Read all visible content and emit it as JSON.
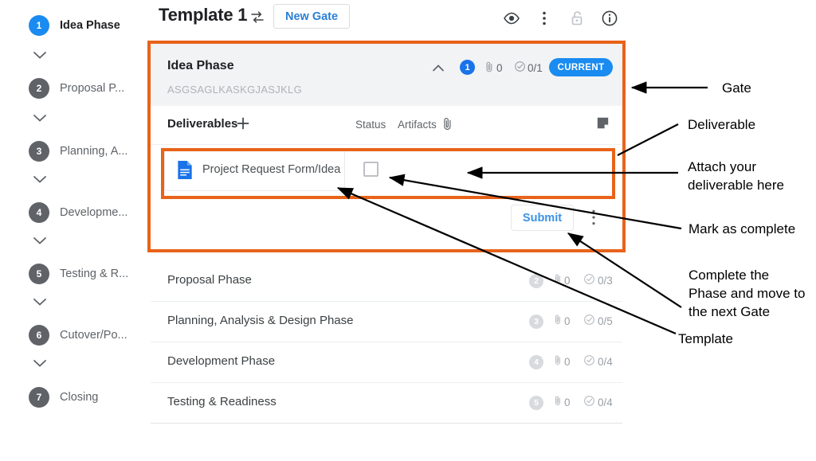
{
  "sidebar": {
    "phases": [
      {
        "num": "1",
        "label": "Idea Phase",
        "active": true
      },
      {
        "num": "2",
        "label": "Proposal P...",
        "active": false
      },
      {
        "num": "3",
        "label": "Planning, A...",
        "active": false
      },
      {
        "num": "4",
        "label": "Developme...",
        "active": false
      },
      {
        "num": "5",
        "label": "Testing & R...",
        "active": false
      },
      {
        "num": "6",
        "label": "Cutover/Po...",
        "active": false
      },
      {
        "num": "7",
        "label": "Closing",
        "active": false
      }
    ]
  },
  "header": {
    "title": "Template 1",
    "swap_icon": "swap-icon",
    "new_gate_label": "New Gate",
    "icons": [
      {
        "name": "eye-icon"
      },
      {
        "name": "more-vertical-icon"
      },
      {
        "name": "unlock-icon"
      },
      {
        "name": "info-icon"
      }
    ]
  },
  "gate": {
    "title": "Idea Phase",
    "subtitle": "ASGSAGLKASKGJASJKLG",
    "collapse_icon": "chevron-up-icon",
    "number_badge": "1",
    "attachments": "0",
    "completed": "0/1",
    "status_pill": "CURRENT",
    "accent_color": "#1a8bf0"
  },
  "deliverables": {
    "section_label": "Deliverables",
    "add_icon": "plus-icon",
    "columns": {
      "status": "Status",
      "artifacts": "Artifacts",
      "artifacts_icon": "paperclip-icon"
    },
    "notes_icon": "note-icon",
    "rows": [
      {
        "icon": "document-icon",
        "name": "Project Request Form/Idea S...",
        "checked": false
      }
    ],
    "submit_label": "Submit",
    "submit_more_icon": "more-vertical-icon"
  },
  "phase_list": [
    {
      "name": "Proposal Phase",
      "badge": "2",
      "attachments": "0",
      "completed": "0/3"
    },
    {
      "name": "Planning, Analysis & Design Phase",
      "badge": "3",
      "attachments": "0",
      "completed": "0/5"
    },
    {
      "name": "Development Phase",
      "badge": "4",
      "attachments": "0",
      "completed": "0/4"
    },
    {
      "name": "Testing & Readiness",
      "badge": "5",
      "attachments": "0",
      "completed": "0/4"
    }
  ],
  "annotations": {
    "highlight_color": "#e8631a",
    "labels": [
      {
        "id": "gate",
        "text": "Gate"
      },
      {
        "id": "deliverable",
        "text": "Deliverable"
      },
      {
        "id": "attach",
        "text": "Attach your\ndeliverable here"
      },
      {
        "id": "mark_complete",
        "text": "Mark as complete"
      },
      {
        "id": "complete_phase",
        "text": "Complete the\nPhase and move to\nthe next Gate"
      },
      {
        "id": "template",
        "text": "Template"
      }
    ]
  }
}
